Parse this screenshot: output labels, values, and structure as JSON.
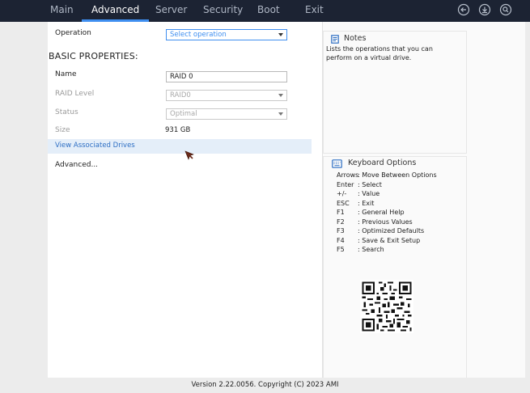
{
  "nav": {
    "tabs": [
      {
        "label": "Main"
      },
      {
        "label": "Advanced"
      },
      {
        "label": "Server"
      },
      {
        "label": "Security"
      },
      {
        "label": "Boot"
      },
      {
        "label": "Exit"
      }
    ],
    "active_tab": "Advanced",
    "icons": [
      "back-icon",
      "download-icon",
      "search-icon"
    ]
  },
  "form": {
    "operation": {
      "label": "Operation",
      "placeholder": "Select operation"
    },
    "section_heading": "BASIC PROPERTIES:",
    "name": {
      "label": "Name",
      "value": "RAID 0"
    },
    "raid_level": {
      "label": "RAID Level",
      "value": "RAID0"
    },
    "status": {
      "label": "Status",
      "value": "Optimal"
    },
    "size": {
      "label": "Size",
      "value": "931 GB"
    },
    "view_drives": "View Associated Drives",
    "advanced": "Advanced..."
  },
  "notes": {
    "title": "Notes",
    "text": "Lists the operations that you can perform on a virtual drive."
  },
  "keyboard": {
    "title": "Keyboard Options",
    "options": [
      {
        "key": "Arrows",
        "desc": ": Move Between Options"
      },
      {
        "key": "Enter",
        "desc": ": Select"
      },
      {
        "key": "+/-",
        "desc": ": Value"
      },
      {
        "key": "ESC",
        "desc": ": Exit"
      },
      {
        "key": "F1",
        "desc": ": General Help"
      },
      {
        "key": "F2",
        "desc": ": Previous Values"
      },
      {
        "key": "F3",
        "desc": ": Optimized Defaults"
      },
      {
        "key": "F4",
        "desc": ": Save & Exit Setup"
      },
      {
        "key": "F5",
        "desc": ": Search"
      }
    ]
  },
  "footer": "Version 2.22.0056. Copyright (C) 2023 AMI",
  "colors": {
    "topbar": "#1c2333",
    "accent": "#3f8ff0",
    "link": "#2e6fc4",
    "highlight_row": "#e4eef9"
  }
}
